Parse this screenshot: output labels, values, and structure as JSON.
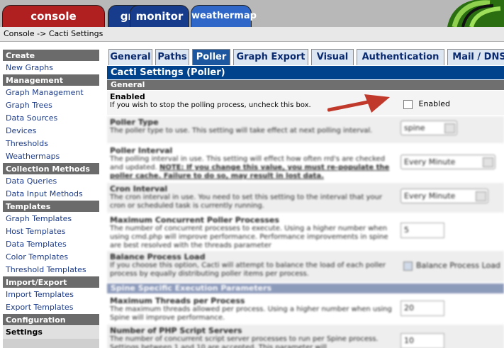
{
  "main_tabs": {
    "console": "console",
    "graphs": "graphs",
    "monitor": "monitor",
    "weathermap": "weathermap"
  },
  "breadcrumb": "Console -> Cacti Settings",
  "sidebar": [
    {
      "type": "head",
      "label": "Create"
    },
    {
      "type": "item",
      "label": "New Graphs"
    },
    {
      "type": "head",
      "label": "Management"
    },
    {
      "type": "item",
      "label": "Graph Management"
    },
    {
      "type": "item",
      "label": "Graph Trees"
    },
    {
      "type": "item",
      "label": "Data Sources"
    },
    {
      "type": "item",
      "label": "Devices"
    },
    {
      "type": "item",
      "label": "Thresholds"
    },
    {
      "type": "item",
      "label": "Weathermaps"
    },
    {
      "type": "head",
      "label": "Collection Methods"
    },
    {
      "type": "item",
      "label": "Data Queries"
    },
    {
      "type": "item",
      "label": "Data Input Methods"
    },
    {
      "type": "head",
      "label": "Templates"
    },
    {
      "type": "item",
      "label": "Graph Templates"
    },
    {
      "type": "item",
      "label": "Host Templates"
    },
    {
      "type": "item",
      "label": "Data Templates"
    },
    {
      "type": "item",
      "label": "Color Templates"
    },
    {
      "type": "item",
      "label": "Threshold Templates"
    },
    {
      "type": "head",
      "label": "Import/Export"
    },
    {
      "type": "item",
      "label": "Import Templates"
    },
    {
      "type": "item",
      "label": "Export Templates"
    },
    {
      "type": "head",
      "label": "Configuration"
    },
    {
      "type": "item",
      "label": "Settings",
      "selected": true
    }
  ],
  "settings_tabs": [
    "General",
    "Paths",
    "Poller",
    "Graph Export",
    "Visual",
    "Authentication",
    "Mail / DNS"
  ],
  "page_title": "Cacti Settings (Poller)",
  "sections": {
    "general": "General",
    "spine": "Spine Specific Execution Parameters"
  },
  "enabled": {
    "title": "Enabled",
    "desc": "If you wish to stop the polling process, uncheck this box.",
    "checkbox_label": "Enabled"
  },
  "poller_type": {
    "title": "Poller Type",
    "desc": "The poller type to use. This setting will take effect at next polling interval.",
    "value": "spine"
  },
  "poller_interval": {
    "title": "Poller Interval",
    "desc": "The polling interval in use. This setting will effect how often rrd's are checked and updated.",
    "note": "NOTE: If you change this value, you must re-populate the poller cache. Failure to do so, may result in lost data.",
    "value": "Every Minute"
  },
  "cron_interval": {
    "title": "Cron Interval",
    "desc": "The cron interval in use. You need to set this setting to the interval that your cron or scheduled task is currently running.",
    "value": "Every Minute"
  },
  "max_processes": {
    "title": "Maximum Concurrent Poller Processes",
    "desc": "The number of concurrent processes to execute. Using a higher number when using cmd.php will improve performance. Performance improvements in spine are best resolved with the threads parameter",
    "value": "5"
  },
  "balance": {
    "title": "Balance Process Load",
    "desc": "If you choose this option, Cacti will attempt to balance the load of each poller process by equally distributing poller items per process.",
    "checkbox_label": "Balance Process Load"
  },
  "max_threads": {
    "title": "Maximum Threads per Process",
    "desc": "The maximum threads allowed per process. Using a higher number when using Spine will improve performance.",
    "value": "20"
  },
  "php_servers": {
    "title": "Number of PHP Script Servers",
    "desc": "The number of concurrent script server processes to run per Spine process. Settings between 1 and 10 are accepted. This parameter will",
    "value": "10"
  },
  "colors": {
    "accent": "#00438c",
    "console_tab": "#b02020",
    "graphs_tab": "#183c8c",
    "arrow": "#c0392b"
  }
}
